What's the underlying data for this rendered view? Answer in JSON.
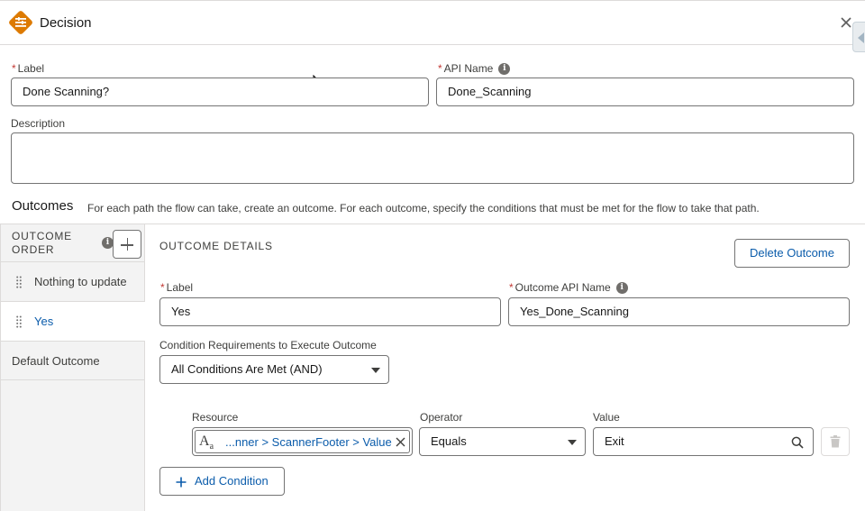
{
  "header": {
    "title": "Decision",
    "icon": "decision-icon",
    "accent_color": "#dd7a01"
  },
  "form": {
    "label_label": "Label",
    "label_value": "Done Scanning?",
    "api_name_label": "API Name",
    "api_name_value": "Done_Scanning",
    "description_label": "Description",
    "description_value": "",
    "required_marker": "*"
  },
  "outcomes": {
    "title": "Outcomes",
    "description": "For each path the flow can take, create an outcome. For each outcome, specify the conditions that must be met for the flow to take that path.",
    "order_header_line1": "OUTCOME",
    "order_header_line2": "ORDER",
    "items": [
      {
        "label": "Nothing to update",
        "selected": false
      },
      {
        "label": "Yes",
        "selected": true
      }
    ],
    "default_outcome": "Default Outcome"
  },
  "details": {
    "header": "OUTCOME DETAILS",
    "delete_button": "Delete Outcome",
    "label_label": "Label",
    "label_value": "Yes",
    "api_name_label": "Outcome API Name",
    "api_name_value": "Yes_Done_Scanning",
    "condition_req_label": "Condition Requirements to Execute Outcome",
    "condition_req_value": "All Conditions Are Met (AND)",
    "condition": {
      "resource_label": "Resource",
      "resource_value": "...nner > ScannerFooter > Value",
      "operator_label": "Operator",
      "operator_value": "Equals",
      "value_label": "Value",
      "value_value": "Exit"
    },
    "add_condition_button": "Add Condition"
  },
  "colors": {
    "link": "#0b5cab",
    "required": "#c23934",
    "border": "#747474"
  }
}
